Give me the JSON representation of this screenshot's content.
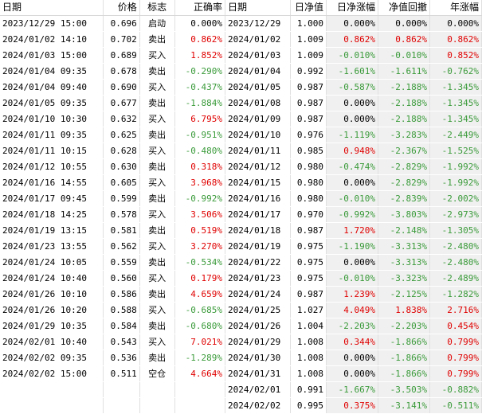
{
  "left_table": {
    "headers": [
      "日期",
      "价格",
      "标志",
      "正确率"
    ],
    "rows": [
      {
        "time": "2023/12/29 15:00",
        "price": "0.696",
        "mark": "启动",
        "rate": "0.000%",
        "rate_color": "black"
      },
      {
        "time": "2024/01/02 14:10",
        "price": "0.702",
        "mark": "卖出",
        "rate": "0.862%",
        "rate_color": "red"
      },
      {
        "time": "2024/01/03 15:00",
        "price": "0.689",
        "mark": "买入",
        "rate": "1.852%",
        "rate_color": "red"
      },
      {
        "time": "2024/01/04 09:35",
        "price": "0.678",
        "mark": "卖出",
        "rate": "-0.290%",
        "rate_color": "green"
      },
      {
        "time": "2024/01/04 09:40",
        "price": "0.690",
        "mark": "买入",
        "rate": "-0.437%",
        "rate_color": "green"
      },
      {
        "time": "2024/01/05 09:35",
        "price": "0.677",
        "mark": "卖出",
        "rate": "-1.884%",
        "rate_color": "green"
      },
      {
        "time": "2024/01/10 10:30",
        "price": "0.632",
        "mark": "买入",
        "rate": "6.795%",
        "rate_color": "red"
      },
      {
        "time": "2024/01/11 09:35",
        "price": "0.625",
        "mark": "卖出",
        "rate": "-0.951%",
        "rate_color": "green"
      },
      {
        "time": "2024/01/11 10:15",
        "price": "0.628",
        "mark": "买入",
        "rate": "-0.480%",
        "rate_color": "green"
      },
      {
        "time": "2024/01/12 10:55",
        "price": "0.630",
        "mark": "卖出",
        "rate": "0.318%",
        "rate_color": "red"
      },
      {
        "time": "2024/01/16 14:55",
        "price": "0.605",
        "mark": "买入",
        "rate": "3.968%",
        "rate_color": "red"
      },
      {
        "time": "2024/01/17 09:45",
        "price": "0.599",
        "mark": "卖出",
        "rate": "-0.992%",
        "rate_color": "green"
      },
      {
        "time": "2024/01/18 14:25",
        "price": "0.578",
        "mark": "买入",
        "rate": "3.506%",
        "rate_color": "red"
      },
      {
        "time": "2024/01/19 13:15",
        "price": "0.581",
        "mark": "卖出",
        "rate": "0.519%",
        "rate_color": "red"
      },
      {
        "time": "2024/01/23 13:55",
        "price": "0.562",
        "mark": "买入",
        "rate": "3.270%",
        "rate_color": "red"
      },
      {
        "time": "2024/01/24 10:05",
        "price": "0.559",
        "mark": "卖出",
        "rate": "-0.534%",
        "rate_color": "green"
      },
      {
        "time": "2024/01/24 10:40",
        "price": "0.560",
        "mark": "买入",
        "rate": "0.179%",
        "rate_color": "red"
      },
      {
        "time": "2024/01/26 10:10",
        "price": "0.586",
        "mark": "卖出",
        "rate": "4.659%",
        "rate_color": "red"
      },
      {
        "time": "2024/01/26 10:20",
        "price": "0.588",
        "mark": "买入",
        "rate": "-0.685%",
        "rate_color": "green"
      },
      {
        "time": "2024/01/29 10:35",
        "price": "0.584",
        "mark": "卖出",
        "rate": "-0.680%",
        "rate_color": "green"
      },
      {
        "time": "2024/02/01 10:40",
        "price": "0.543",
        "mark": "买入",
        "rate": "7.021%",
        "rate_color": "red"
      },
      {
        "time": "2024/02/02 09:35",
        "price": "0.536",
        "mark": "卖出",
        "rate": "-1.289%",
        "rate_color": "green"
      },
      {
        "time": "2024/02/02 15:00",
        "price": "0.511",
        "mark": "空仓",
        "rate": "4.664%",
        "rate_color": "red"
      }
    ]
  },
  "right_table": {
    "headers": [
      "日期",
      "日净值",
      "日净涨幅",
      "净值回撤",
      "年涨幅"
    ],
    "rows": [
      {
        "date": "2023/12/29",
        "nav": "1.000",
        "daily": "0.000%",
        "daily_color": "black",
        "dd": "0.000%",
        "dd_color": "black",
        "year": "0.000%",
        "year_color": "black"
      },
      {
        "date": "2024/01/02",
        "nav": "1.009",
        "daily": "0.862%",
        "daily_color": "red",
        "dd": "0.862%",
        "dd_color": "red",
        "year": "0.862%",
        "year_color": "red"
      },
      {
        "date": "2024/01/03",
        "nav": "1.009",
        "daily": "-0.010%",
        "daily_color": "green",
        "dd": "-0.010%",
        "dd_color": "green",
        "year": "0.852%",
        "year_color": "red"
      },
      {
        "date": "2024/01/04",
        "nav": "0.992",
        "daily": "-1.601%",
        "daily_color": "green",
        "dd": "-1.611%",
        "dd_color": "green",
        "year": "-0.762%",
        "year_color": "green"
      },
      {
        "date": "2024/01/05",
        "nav": "0.987",
        "daily": "-0.587%",
        "daily_color": "green",
        "dd": "-2.188%",
        "dd_color": "green",
        "year": "-1.345%",
        "year_color": "green"
      },
      {
        "date": "2024/01/08",
        "nav": "0.987",
        "daily": "0.000%",
        "daily_color": "black",
        "dd": "-2.188%",
        "dd_color": "green",
        "year": "-1.345%",
        "year_color": "green"
      },
      {
        "date": "2024/01/09",
        "nav": "0.987",
        "daily": "0.000%",
        "daily_color": "black",
        "dd": "-2.188%",
        "dd_color": "green",
        "year": "-1.345%",
        "year_color": "green"
      },
      {
        "date": "2024/01/10",
        "nav": "0.976",
        "daily": "-1.119%",
        "daily_color": "green",
        "dd": "-3.283%",
        "dd_color": "green",
        "year": "-2.449%",
        "year_color": "green"
      },
      {
        "date": "2024/01/11",
        "nav": "0.985",
        "daily": "0.948%",
        "daily_color": "red",
        "dd": "-2.367%",
        "dd_color": "green",
        "year": "-1.525%",
        "year_color": "green"
      },
      {
        "date": "2024/01/12",
        "nav": "0.980",
        "daily": "-0.474%",
        "daily_color": "green",
        "dd": "-2.829%",
        "dd_color": "green",
        "year": "-1.992%",
        "year_color": "green"
      },
      {
        "date": "2024/01/15",
        "nav": "0.980",
        "daily": "0.000%",
        "daily_color": "black",
        "dd": "-2.829%",
        "dd_color": "green",
        "year": "-1.992%",
        "year_color": "green"
      },
      {
        "date": "2024/01/16",
        "nav": "0.980",
        "daily": "-0.010%",
        "daily_color": "green",
        "dd": "-2.839%",
        "dd_color": "green",
        "year": "-2.002%",
        "year_color": "green"
      },
      {
        "date": "2024/01/17",
        "nav": "0.970",
        "daily": "-0.992%",
        "daily_color": "green",
        "dd": "-3.803%",
        "dd_color": "green",
        "year": "-2.973%",
        "year_color": "green"
      },
      {
        "date": "2024/01/18",
        "nav": "0.987",
        "daily": "1.720%",
        "daily_color": "red",
        "dd": "-2.148%",
        "dd_color": "green",
        "year": "-1.305%",
        "year_color": "green"
      },
      {
        "date": "2024/01/19",
        "nav": "0.975",
        "daily": "-1.190%",
        "daily_color": "green",
        "dd": "-3.313%",
        "dd_color": "green",
        "year": "-2.480%",
        "year_color": "green"
      },
      {
        "date": "2024/01/22",
        "nav": "0.975",
        "daily": "0.000%",
        "daily_color": "black",
        "dd": "-3.313%",
        "dd_color": "green",
        "year": "-2.480%",
        "year_color": "green"
      },
      {
        "date": "2024/01/23",
        "nav": "0.975",
        "daily": "-0.010%",
        "daily_color": "green",
        "dd": "-3.323%",
        "dd_color": "green",
        "year": "-2.489%",
        "year_color": "green"
      },
      {
        "date": "2024/01/24",
        "nav": "0.987",
        "daily": "1.239%",
        "daily_color": "red",
        "dd": "-2.125%",
        "dd_color": "green",
        "year": "-1.282%",
        "year_color": "green"
      },
      {
        "date": "2024/01/25",
        "nav": "1.027",
        "daily": "4.049%",
        "daily_color": "red",
        "dd": "1.838%",
        "dd_color": "red",
        "year": "2.716%",
        "year_color": "red"
      },
      {
        "date": "2024/01/26",
        "nav": "1.004",
        "daily": "-2.203%",
        "daily_color": "green",
        "dd": "-2.203%",
        "dd_color": "green",
        "year": "0.454%",
        "year_color": "red"
      },
      {
        "date": "2024/01/29",
        "nav": "1.008",
        "daily": "0.344%",
        "daily_color": "red",
        "dd": "-1.866%",
        "dd_color": "green",
        "year": "0.799%",
        "year_color": "red"
      },
      {
        "date": "2024/01/30",
        "nav": "1.008",
        "daily": "0.000%",
        "daily_color": "black",
        "dd": "-1.866%",
        "dd_color": "green",
        "year": "0.799%",
        "year_color": "red"
      },
      {
        "date": "2024/01/31",
        "nav": "1.008",
        "daily": "0.000%",
        "daily_color": "black",
        "dd": "-1.866%",
        "dd_color": "green",
        "year": "0.799%",
        "year_color": "red"
      },
      {
        "date": "2024/02/01",
        "nav": "0.991",
        "daily": "-1.667%",
        "daily_color": "green",
        "dd": "-3.503%",
        "dd_color": "green",
        "year": "-0.882%",
        "year_color": "green"
      },
      {
        "date": "2024/02/02",
        "nav": "0.995",
        "daily": "0.375%",
        "daily_color": "red",
        "dd": "-3.141%",
        "dd_color": "green",
        "year": "-0.511%",
        "year_color": "green"
      }
    ]
  },
  "colors": {
    "positive": "#e00000",
    "negative": "#3a9a3a",
    "neutral": "#000000",
    "shade": "#f0f0f0"
  }
}
